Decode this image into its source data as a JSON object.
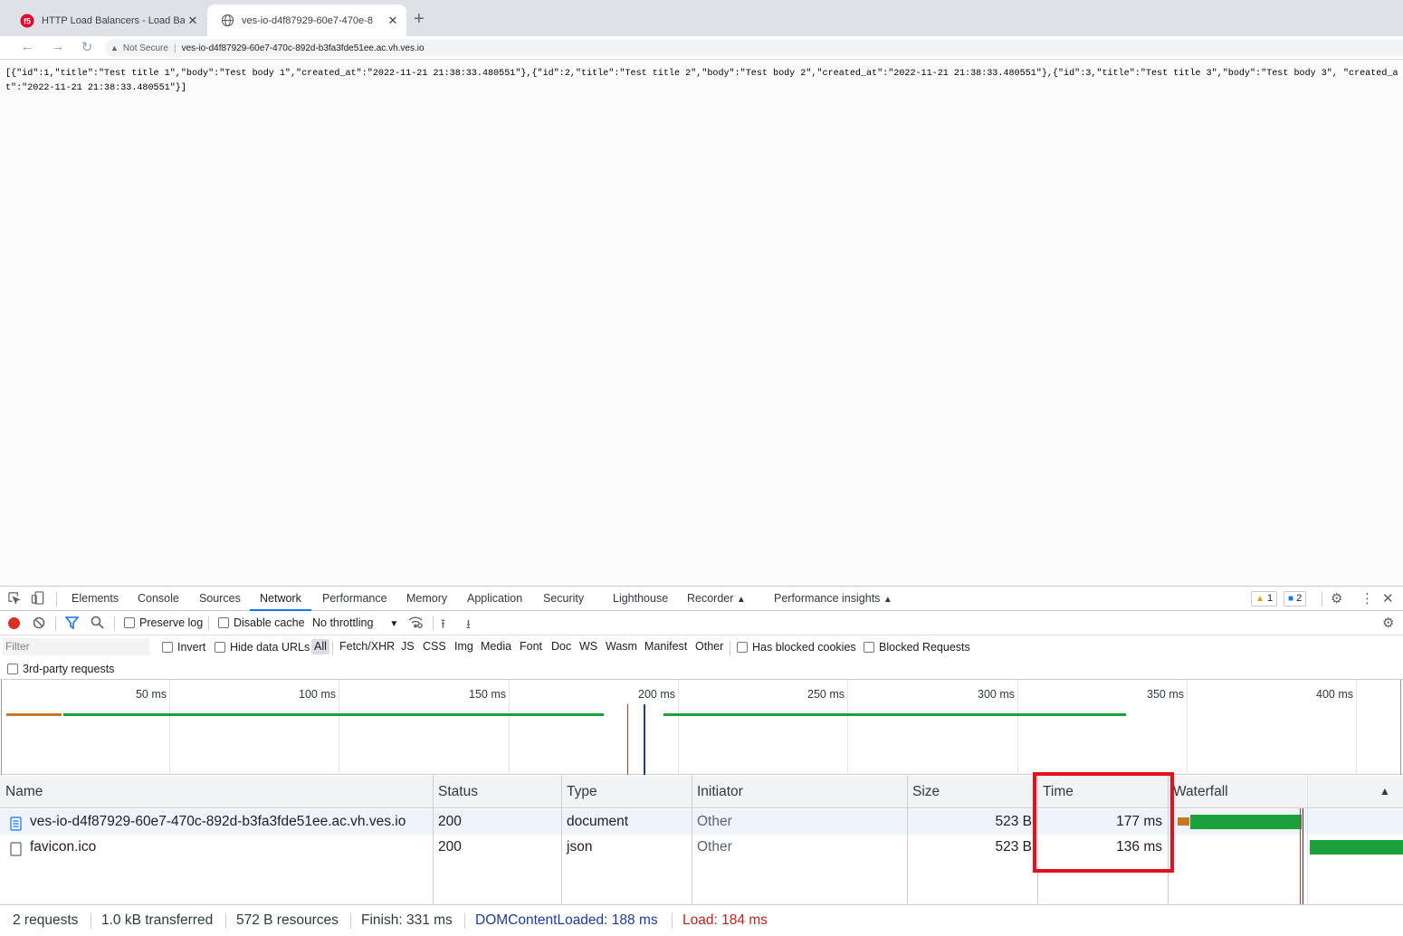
{
  "browser": {
    "tabs": [
      {
        "title": "HTTP Load Balancers - Load Ba",
        "icon": "f5-logo-icon"
      },
      {
        "title": "ves-io-d4f87929-60e7-470e-8",
        "icon": "globe-icon"
      }
    ],
    "security_label": "Not Secure",
    "url": "ves-io-d4f87929-60e7-470c-892d-b3fa3fde51ee.ac.vh.ves.io"
  },
  "page": {
    "json_text": "[{\"id\":1,\"title\":\"Test title 1\",\"body\":\"Test body 1\",\"created_at\":\"2022-11-21 21:38:33.480551\"},{\"id\":2,\"title\":\"Test title 2\",\"body\":\"Test body 2\",\"created_at\":\"2022-11-21 21:38:33.480551\"},{\"id\":3,\"title\":\"Test title 3\",\"body\":\"Test body 3\", \"created_at\":\"2022-11-21 21:38:33.480551\"}]"
  },
  "devtools": {
    "tabs": [
      "Elements",
      "Console",
      "Sources",
      "Network",
      "Performance",
      "Memory",
      "Application",
      "Security",
      "Lighthouse",
      "Recorder",
      "Performance insights"
    ],
    "active_tab": "Network",
    "warnings_count": "1",
    "messages_count": "2",
    "toolbar": {
      "preserve_log": "Preserve log",
      "disable_cache": "Disable cache",
      "throttling": "No throttling"
    },
    "filter": {
      "placeholder": "Filter",
      "invert": "Invert",
      "hide_data_urls": "Hide data URLs",
      "types": [
        "All",
        "Fetch/XHR",
        "JS",
        "CSS",
        "Img",
        "Media",
        "Font",
        "Doc",
        "WS",
        "Wasm",
        "Manifest",
        "Other"
      ],
      "selected_type": "All",
      "has_blocked_cookies": "Has blocked cookies",
      "blocked_requests": "Blocked Requests",
      "third_party": "3rd-party requests"
    },
    "overview": {
      "ticks": [
        "50 ms",
        "100 ms",
        "150 ms",
        "200 ms",
        "250 ms",
        "300 ms",
        "350 ms",
        "400 ms"
      ],
      "dom_content_loaded_ms": 188,
      "load_ms": 184
    },
    "table": {
      "columns": [
        "Name",
        "Status",
        "Type",
        "Initiator",
        "Size",
        "Time",
        "Waterfall"
      ],
      "rows": [
        {
          "name": "ves-io-d4f87929-60e7-470c-892d-b3fa3fde51ee.ac.vh.ves.io",
          "status": "200",
          "type": "document",
          "initiator": "Other",
          "size": "523 B",
          "time": "177 ms",
          "icon": "document-icon"
        },
        {
          "name": "favicon.ico",
          "status": "200",
          "type": "json",
          "initiator": "Other",
          "size": "523 B",
          "time": "136 ms",
          "icon": "file-icon"
        }
      ]
    },
    "footer": {
      "requests": "2 requests",
      "transferred": "1.0 kB transferred",
      "resources": "572 B resources",
      "finish": "Finish: 331 ms",
      "dcl": "DOMContentLoaded: 188 ms",
      "load": "Load: 184 ms"
    },
    "colors": {
      "accent": "#1a73e8",
      "waiting": "#c47a1f",
      "download": "#1aa13b",
      "load_line": "#d93025",
      "dcl_line": "#1a3d9e",
      "highlight": "#e3101d"
    }
  }
}
